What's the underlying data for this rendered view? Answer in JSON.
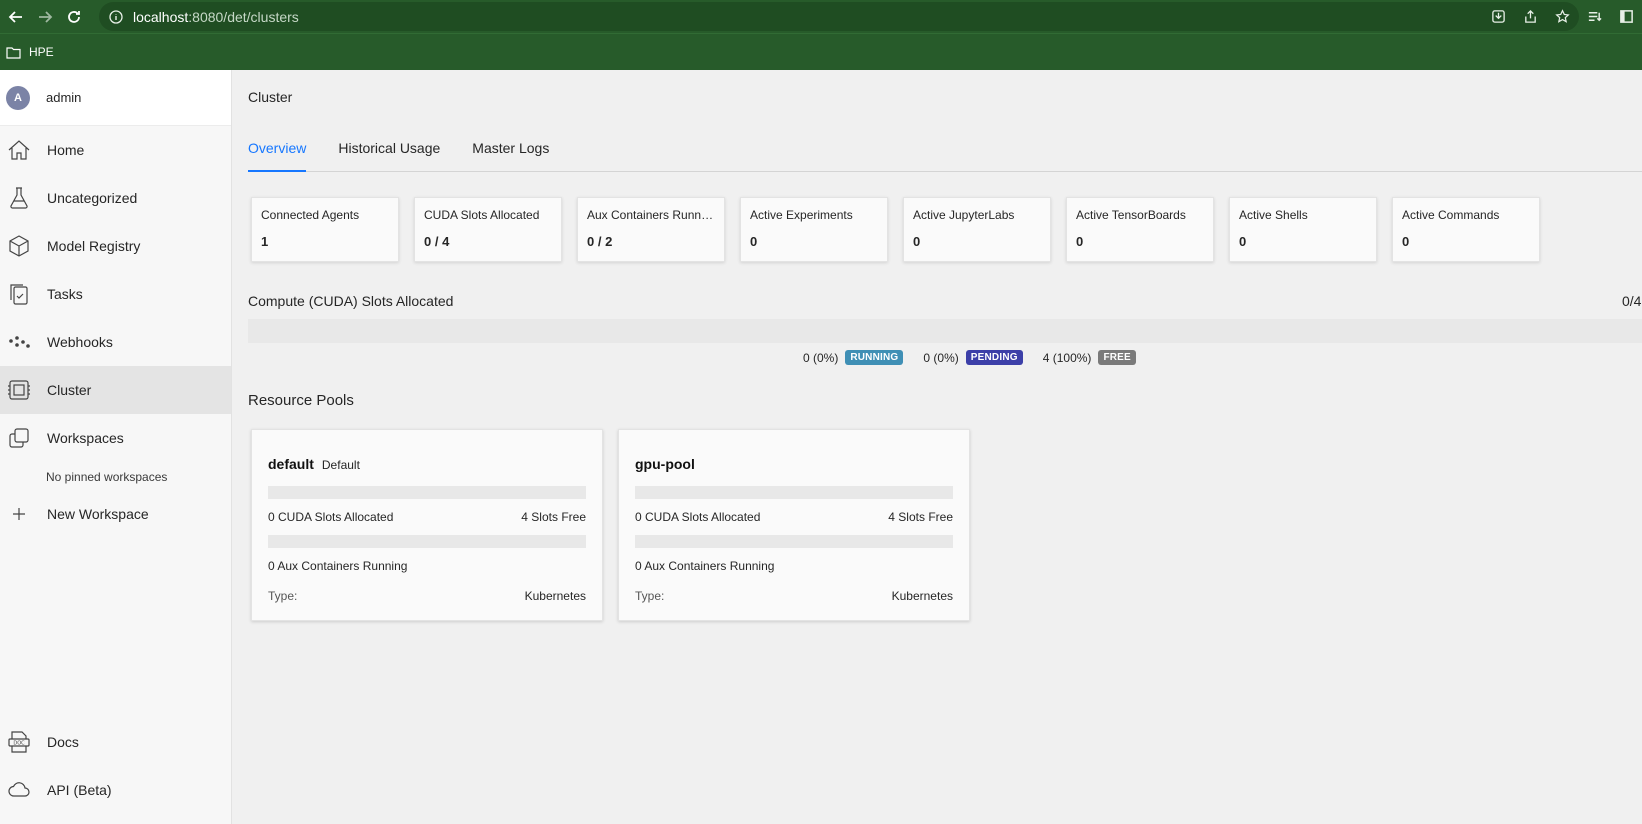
{
  "browser": {
    "url_host": "localhost",
    "url_path": ":8080/det/clusters",
    "bookmark": "HPE"
  },
  "sidebar": {
    "user": {
      "initial": "A",
      "name": "admin"
    },
    "items": [
      {
        "label": "Home",
        "icon": "home-icon"
      },
      {
        "label": "Uncategorized",
        "icon": "flask-icon"
      },
      {
        "label": "Model Registry",
        "icon": "cube-icon"
      },
      {
        "label": "Tasks",
        "icon": "tasks-icon"
      },
      {
        "label": "Webhooks",
        "icon": "webhooks-icon"
      },
      {
        "label": "Cluster",
        "icon": "cluster-icon",
        "active": true
      },
      {
        "label": "Workspaces",
        "icon": "workspaces-icon"
      }
    ],
    "no_pinned": "No pinned workspaces",
    "new_workspace": "New Workspace",
    "bottom": [
      {
        "label": "Docs",
        "icon": "docs-icon"
      },
      {
        "label": "API (Beta)",
        "icon": "cloud-icon"
      }
    ]
  },
  "main": {
    "title": "Cluster",
    "tabs": [
      {
        "label": "Overview",
        "active": true
      },
      {
        "label": "Historical Usage"
      },
      {
        "label": "Master Logs"
      }
    ],
    "stats": [
      {
        "label": "Connected Agents",
        "value": "1"
      },
      {
        "label": "CUDA Slots Allocated",
        "value": "0 / 4"
      },
      {
        "label": "Aux Containers Running",
        "value": "0 / 2"
      },
      {
        "label": "Active Experiments",
        "value": "0"
      },
      {
        "label": "Active JupyterLabs",
        "value": "0"
      },
      {
        "label": "Active TensorBoards",
        "value": "0"
      },
      {
        "label": "Active Shells",
        "value": "0"
      },
      {
        "label": "Active Commands",
        "value": "0"
      }
    ],
    "compute": {
      "title": "Compute (CUDA) Slots Allocated",
      "ratio": "0/4",
      "legend": [
        {
          "value": "0 (0%)",
          "badge": "RUNNING",
          "color": "#3f8fb5"
        },
        {
          "value": "0 (0%)",
          "badge": "PENDING",
          "color": "#3c3fa8"
        },
        {
          "value": "4 (100%)",
          "badge": "FREE",
          "color": "#7a7a7a"
        }
      ]
    },
    "resource_pools_title": "Resource Pools",
    "pools": [
      {
        "name": "default",
        "default_label": "Default",
        "cuda_allocated": "0 CUDA Slots Allocated",
        "slots_free": "4 Slots Free",
        "aux_running": "0 Aux Containers Running",
        "type_label": "Type:",
        "type_value": "Kubernetes"
      },
      {
        "name": "gpu-pool",
        "default_label": "",
        "cuda_allocated": "0 CUDA Slots Allocated",
        "slots_free": "4 Slots Free",
        "aux_running": "0 Aux Containers Running",
        "type_label": "Type:",
        "type_value": "Kubernetes"
      }
    ]
  }
}
